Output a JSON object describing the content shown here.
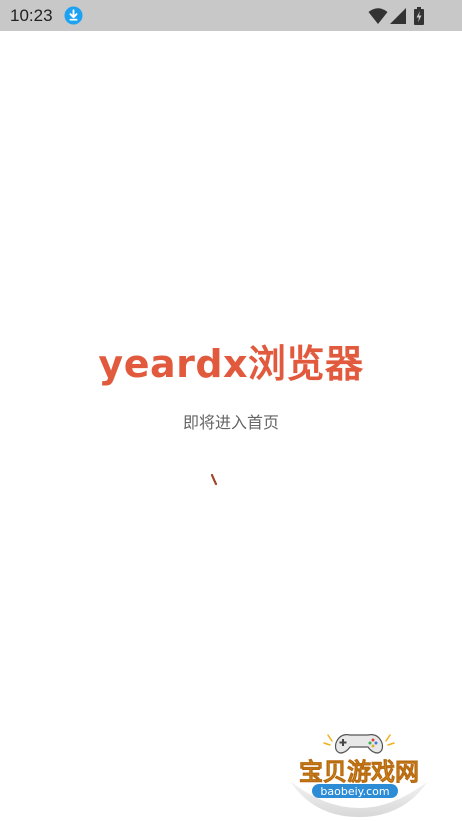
{
  "status_bar": {
    "time": "10:23",
    "icons": [
      "download-icon",
      "wifi-icon",
      "signal-icon",
      "battery-charging-icon"
    ],
    "background": "#c8c8c8"
  },
  "splash": {
    "title": "yeardx浏览器",
    "subtitle": "即将进入首页",
    "title_color": "#e25a3e"
  },
  "watermark": {
    "name": "宝贝游戏网",
    "url": "baobeiy.com"
  }
}
